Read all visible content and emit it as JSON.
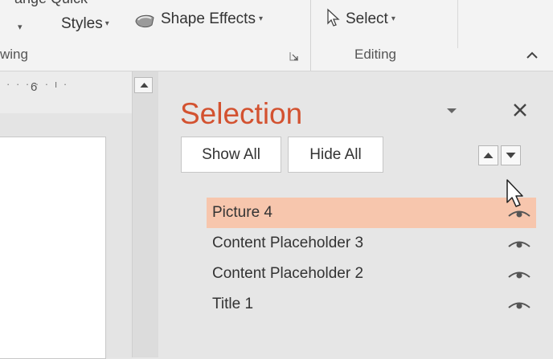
{
  "ribbon": {
    "cut_text": "ange  Quick",
    "styles_label": "Styles",
    "shape_effects_label": "Shape Effects",
    "select_label": "Select",
    "group_drawing": "wing",
    "group_editing": "Editing"
  },
  "ruler": {
    "tick_label": "6"
  },
  "pane": {
    "title": "Selection",
    "show_all": "Show All",
    "hide_all": "Hide All",
    "items": [
      {
        "label": "Picture 4",
        "selected": true
      },
      {
        "label": "Content Placeholder 3",
        "selected": false
      },
      {
        "label": "Content Placeholder 2",
        "selected": false
      },
      {
        "label": "Title 1",
        "selected": false
      }
    ]
  },
  "colors": {
    "accent": "#d35230",
    "selected_row": "#f7c6ad",
    "pane_bg": "#e6e6e6"
  },
  "icons": [
    "shape-effects-icon",
    "select-cursor-icon",
    "dialog-launcher-icon",
    "collapse-ribbon-icon",
    "scroll-up-icon",
    "dropdown-icon",
    "close-icon",
    "bring-forward-icon",
    "send-backward-icon",
    "eye-icon",
    "mouse-cursor-icon"
  ]
}
